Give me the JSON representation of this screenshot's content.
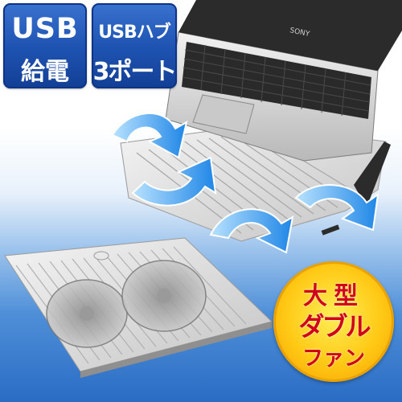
{
  "badges": {
    "usb_power": {
      "line1": "USB",
      "line2": "給電"
    },
    "usb_hub": {
      "line1": "USBハブ",
      "line2": "3ポート"
    }
  },
  "feature_badge": {
    "line1": "大型",
    "line2": "ダブル",
    "line3": "ファン"
  },
  "laptop": {
    "brand": "SONY"
  },
  "colors": {
    "badge_blue": "#1f54b3",
    "feature_yellow": "#ffc814",
    "feature_red": "#d0001a",
    "arrow_blue": "#2f8de0",
    "cooler_silver": "#d9d9d9"
  }
}
